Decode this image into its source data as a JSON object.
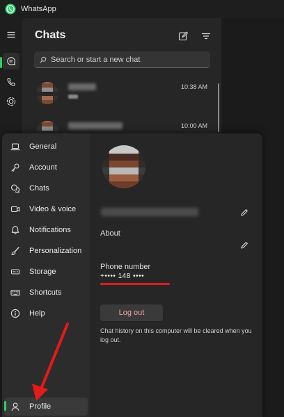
{
  "app": {
    "title": "WhatsApp"
  },
  "chat_list": {
    "title": "Chats",
    "search": {
      "placeholder": "Search or start a new chat"
    },
    "rows": [
      {
        "time": "10:38 AM"
      },
      {
        "time": "10:00 AM"
      }
    ]
  },
  "settings": {
    "nav": [
      {
        "label": "General",
        "icon": "laptop-icon"
      },
      {
        "label": "Account",
        "icon": "key-icon"
      },
      {
        "label": "Chats",
        "icon": "chats-icon"
      },
      {
        "label": "Video & voice",
        "icon": "video-icon"
      },
      {
        "label": "Notifications",
        "icon": "bell-icon"
      },
      {
        "label": "Personalization",
        "icon": "brush-icon"
      },
      {
        "label": "Storage",
        "icon": "storage-icon"
      },
      {
        "label": "Shortcuts",
        "icon": "keyboard-icon"
      },
      {
        "label": "Help",
        "icon": "info-icon"
      }
    ],
    "profile_nav": {
      "label": "Profile",
      "icon": "person-icon"
    },
    "profile": {
      "about_label": "About",
      "phone_label": "Phone number",
      "phone_value": "+•••• 148 ••••",
      "logout_label": "Log out",
      "logout_note": "Chat history on this computer will be cleared when you log out."
    }
  },
  "colors": {
    "accent": "#25d366",
    "annotation": "#e21b1b",
    "logout_text": "#f3a4a4"
  }
}
